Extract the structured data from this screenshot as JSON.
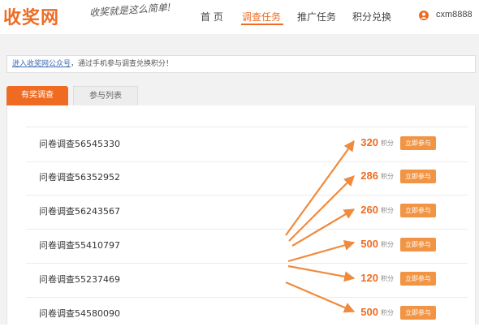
{
  "header": {
    "logo": "收奖网",
    "slogan": "收奖就是这么简单!",
    "nav": [
      {
        "label": "首 页",
        "active": false
      },
      {
        "label": "调查任务",
        "active": true
      },
      {
        "label": "推广任务",
        "active": false
      },
      {
        "label": "积分兑换",
        "active": false
      }
    ],
    "username": "cxm8888"
  },
  "notice": {
    "link": "进入收奖网公众号",
    "text": "，通过手机参与调查兑换积分！"
  },
  "tabs": [
    {
      "label": "有奖调查",
      "active": true
    },
    {
      "label": "参与列表",
      "active": false
    }
  ],
  "surveys": [
    {
      "title": "问卷调查56545330",
      "points": "320",
      "unit": "积分",
      "button": "立即参与"
    },
    {
      "title": "问卷调查56352952",
      "points": "286",
      "unit": "积分",
      "button": "立即参与"
    },
    {
      "title": "问卷调查56243567",
      "points": "260",
      "unit": "积分",
      "button": "立即参与"
    },
    {
      "title": "问卷调查55410797",
      "points": "500",
      "unit": "积分",
      "button": "立即参与"
    },
    {
      "title": "问卷调查55237469",
      "points": "120",
      "unit": "积分",
      "button": "立即参与"
    },
    {
      "title": "问卷调查54580090",
      "points": "500",
      "unit": "积分",
      "button": "立即参与"
    }
  ],
  "colors": {
    "accent": "#ef6b22",
    "button": "#f19444",
    "arrow": "#f08a3c"
  }
}
